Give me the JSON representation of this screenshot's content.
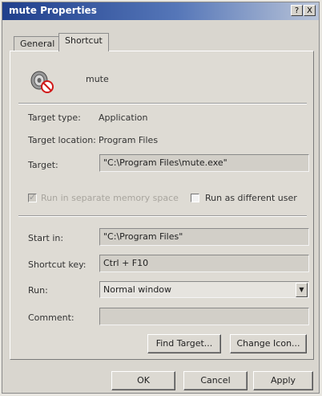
{
  "window": {
    "title": "mute Properties",
    "help_label": "?",
    "close_label": "X"
  },
  "tabs": [
    {
      "label": "General"
    },
    {
      "label": "Shortcut"
    }
  ],
  "shortcut": {
    "name": "mute",
    "icon": "speaker-muted-icon"
  },
  "target_type": {
    "label": "Target type:",
    "value": "Application"
  },
  "target_location": {
    "label": "Target location:",
    "value": "Program Files"
  },
  "target": {
    "label": "Target:",
    "value": "\"C:\\Program Files\\mute.exe\""
  },
  "options": {
    "separate_memory": {
      "label": "Run in separate memory space",
      "checked": true,
      "disabled": true
    },
    "different_user": {
      "label": "Run as different user",
      "checked": false
    }
  },
  "start_in": {
    "label": "Start in:",
    "value": "\"C:\\Program Files\""
  },
  "shortcut_key": {
    "label": "Shortcut key:",
    "value": "Ctrl + F10"
  },
  "run": {
    "label": "Run:",
    "value": "Normal window"
  },
  "comment": {
    "label": "Comment:",
    "value": ""
  },
  "buttons": {
    "find_target": "Find Target...",
    "change_icon": "Change Icon...",
    "ok": "OK",
    "cancel": "Cancel",
    "apply": "Apply"
  }
}
